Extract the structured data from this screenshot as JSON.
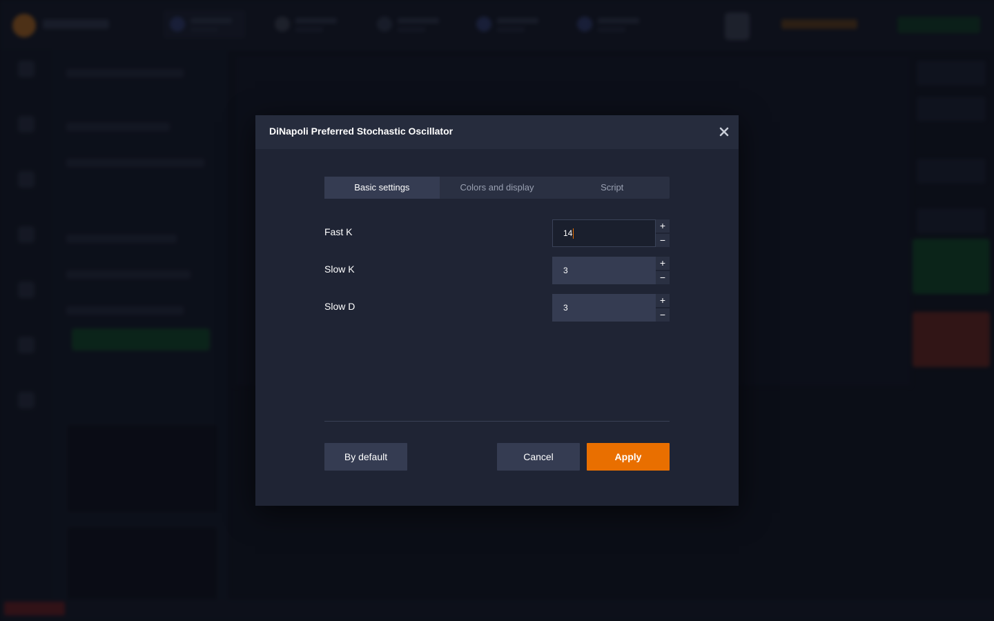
{
  "modal": {
    "title": "DiNapoli Preferred Stochastic Oscillator",
    "close_icon": "close-icon",
    "tabs": [
      {
        "label": "Basic settings",
        "active": true
      },
      {
        "label": "Colors and display",
        "active": false
      },
      {
        "label": "Script",
        "active": false
      }
    ],
    "fields": [
      {
        "label": "Fast K",
        "value": "14",
        "focused": true
      },
      {
        "label": "Slow K",
        "value": "3",
        "focused": false
      },
      {
        "label": "Slow D",
        "value": "3",
        "focused": false
      }
    ],
    "stepper_plus": "+",
    "stepper_minus": "−",
    "buttons": {
      "default_label": "By default",
      "cancel_label": "Cancel",
      "apply_label": "Apply"
    }
  },
  "colors": {
    "accent": "#e96f00",
    "modal_bg": "#1f2434",
    "header_bg": "#262c3d",
    "input_bg": "#353c52"
  }
}
